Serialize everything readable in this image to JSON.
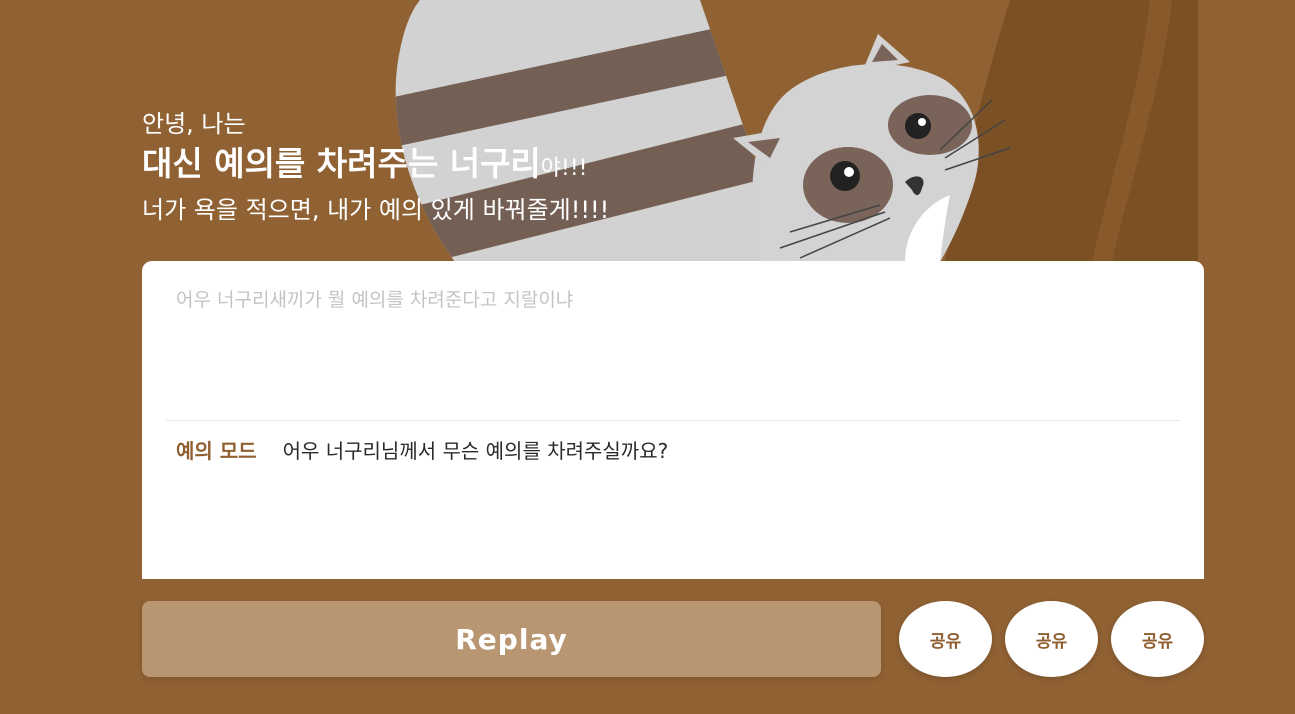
{
  "intro": {
    "greeting": "안녕, 나는",
    "headline_strong": "대신 예의를 차려주는 너구리",
    "headline_suffix": "야!!!",
    "description": "너가 욕을 적으면, 내가 예의 있게 바꿔줄게!!!!"
  },
  "input": {
    "placeholder": "어우 너구리새끼가 뭘 예의를 차려준다고 지랄이냐",
    "value": ""
  },
  "output": {
    "mode_label": "예의 모드",
    "text": "어우 너구리님께서 무슨 예의를 차려주실까요?"
  },
  "controls": {
    "replay_label": "Replay",
    "share_buttons": [
      "공유",
      "공유",
      "공유"
    ]
  },
  "colors": {
    "background": "#8f6133",
    "card": "#ffffff",
    "replay_button": "#b99672",
    "accent_text": "#8f5f30"
  }
}
